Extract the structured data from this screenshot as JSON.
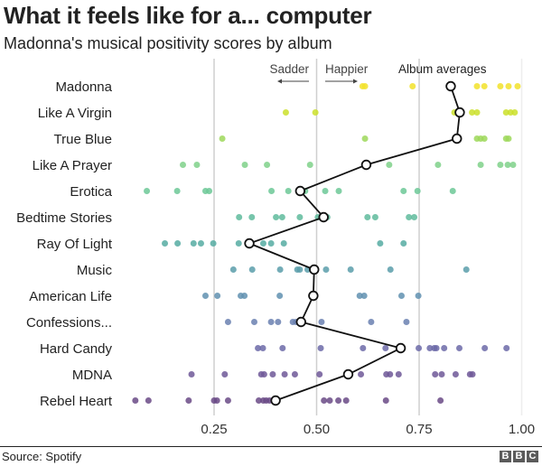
{
  "chart_data": {
    "type": "scatter",
    "title": "What it feels like for a... computer",
    "subtitle": "Madonna's musical positivity scores by album",
    "xlabel": "",
    "ylabel": "",
    "xlim": [
      0,
      1
    ],
    "xticks": [
      0.25,
      0.5,
      0.75,
      1.0
    ],
    "xtick_labels": [
      "0.25",
      "0.50",
      "0.75",
      "1.00"
    ],
    "grid": true,
    "annotations": {
      "sadder": "Sadder",
      "happier": "Happier",
      "averages": "Album averages"
    },
    "albums": [
      {
        "name": "Madonna",
        "color": "#f2e22a",
        "avg": 0.827,
        "tracks": [
          0.612,
          0.618,
          0.734,
          0.891,
          0.909,
          0.948,
          0.968,
          0.99
        ]
      },
      {
        "name": "Like A Virgin",
        "color": "#cbe02a",
        "avg": 0.849,
        "tracks": [
          0.425,
          0.497,
          0.836,
          0.879,
          0.891,
          0.962,
          0.973,
          0.983
        ]
      },
      {
        "name": "True Blue",
        "color": "#9ed85a",
        "avg": 0.842,
        "tracks": [
          0.27,
          0.618,
          0.891,
          0.9,
          0.909,
          0.962,
          0.968
        ]
      },
      {
        "name": "Like A Prayer",
        "color": "#7fd18a",
        "avg": 0.621,
        "tracks": [
          0.174,
          0.208,
          0.325,
          0.379,
          0.484,
          0.677,
          0.796,
          0.9,
          0.948,
          0.966,
          0.979
        ]
      },
      {
        "name": "Erotica",
        "color": "#6cc896",
        "avg": 0.46,
        "tracks": [
          0.086,
          0.16,
          0.229,
          0.238,
          0.39,
          0.431,
          0.472,
          0.521,
          0.554,
          0.712,
          0.746,
          0.832
        ]
      },
      {
        "name": "Bedtime Stories",
        "color": "#5fbb9c",
        "avg": 0.517,
        "tracks": [
          0.311,
          0.342,
          0.401,
          0.416,
          0.459,
          0.503,
          0.526,
          0.624,
          0.643,
          0.725,
          0.738
        ]
      },
      {
        "name": "Ray Of Light",
        "color": "#56aca2",
        "avg": 0.336,
        "tracks": [
          0.13,
          0.161,
          0.2,
          0.218,
          0.248,
          0.31,
          0.37,
          0.389,
          0.42,
          0.655,
          0.712
        ]
      },
      {
        "name": "Music",
        "color": "#5a9eaa",
        "avg": 0.494,
        "tracks": [
          0.297,
          0.343,
          0.411,
          0.453,
          0.459,
          0.478,
          0.523,
          0.583,
          0.68,
          0.865
        ]
      },
      {
        "name": "American Life",
        "color": "#6090b0",
        "avg": 0.492,
        "tracks": [
          0.229,
          0.258,
          0.315,
          0.324,
          0.41,
          0.605,
          0.616,
          0.707,
          0.748
        ]
      },
      {
        "name": "Confessions...",
        "color": "#6a80b0",
        "avg": 0.462,
        "tracks": [
          0.284,
          0.348,
          0.389,
          0.406,
          0.442,
          0.45,
          0.512,
          0.633,
          0.719
        ]
      },
      {
        "name": "Hard Candy",
        "color": "#6c6aa8",
        "avg": 0.705,
        "tracks": [
          0.357,
          0.369,
          0.417,
          0.51,
          0.613,
          0.668,
          0.749,
          0.776,
          0.787,
          0.792,
          0.811,
          0.848,
          0.91,
          0.963
        ]
      },
      {
        "name": "MDNA",
        "color": "#6e5898",
        "avg": 0.577,
        "tracks": [
          0.195,
          0.276,
          0.365,
          0.372,
          0.393,
          0.422,
          0.447,
          0.507,
          0.608,
          0.67,
          0.679,
          0.7,
          0.789,
          0.805,
          0.839,
          0.874,
          0.88
        ]
      },
      {
        "name": "Rebel Heart",
        "color": "#6a4a86",
        "avg": 0.4,
        "tracks": [
          0.058,
          0.09,
          0.188,
          0.25,
          0.257,
          0.284,
          0.359,
          0.37,
          0.377,
          0.385,
          0.518,
          0.532,
          0.553,
          0.572,
          0.669,
          0.802
        ]
      }
    ]
  },
  "footer": {
    "source": "Source: Spotify",
    "logo": [
      "B",
      "B",
      "C"
    ]
  }
}
